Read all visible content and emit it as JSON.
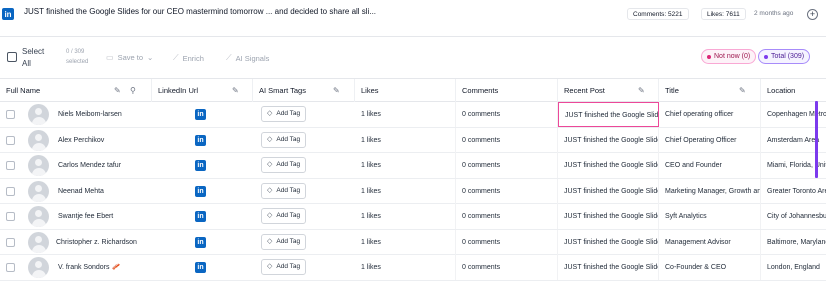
{
  "header": {
    "logo": "in",
    "post_title": "JUST finished the Google Slides for our CEO mastermind tomorrow ... and decided to share all sli...",
    "comments_badge": "Comments: 5221",
    "likes_badge": "Likes: 7611",
    "time_ago": "2 months ago",
    "add_symbol": "+"
  },
  "toolbar": {
    "select_all_label": "Select All",
    "selected_count": "0 / 309 selected",
    "save_to_label": "Save to",
    "save_to_caret": "⌄",
    "enrich_label": "Enrich",
    "ai_signals_label": "AI Signals",
    "not_now_pill": "Not now (0)",
    "total_pill": "Total (309)"
  },
  "columns": {
    "full_name": "Full Name",
    "linkedin_url": "LinkedIn Url",
    "ai_smart_tags": "AI Smart Tags",
    "likes": "Likes",
    "comments": "Comments",
    "recent_post": "Recent Post",
    "title": "Title",
    "location": "Location"
  },
  "add_tag_label": "Add Tag",
  "linkedin_glyph": "in",
  "rows": [
    {
      "name": "Niels Meibom-larsen",
      "likes": "1 likes",
      "comments": "0 comments",
      "recent_post": "JUST finished the Google Slides",
      "title": "Chief operating officer",
      "location": "Copenhagen Metropolitan"
    },
    {
      "name": "Alex Perchikov",
      "likes": "1 likes",
      "comments": "0 comments",
      "recent_post": "JUST finished the Google Slides",
      "title": "Chief Operating Officer",
      "location": "Amsterdam Area"
    },
    {
      "name": "Carlos Mendez tafur",
      "likes": "1 likes",
      "comments": "0 comments",
      "recent_post": "JUST finished the Google Slides",
      "title": "CEO and Founder",
      "location": "Miami, Florida, United"
    },
    {
      "name": "Neenad Mehta",
      "likes": "1 likes",
      "comments": "0 comments",
      "recent_post": "JUST finished the Google Slides",
      "title": "Marketing Manager, Growth and",
      "location": "Greater Toronto Area"
    },
    {
      "name": "Swantje fee Ebert",
      "likes": "1 likes",
      "comments": "0 comments",
      "recent_post": "JUST finished the Google Slides",
      "title": "Syft Analytics",
      "location": "City of Johannesburg"
    },
    {
      "name": "Christopher z. Richardson",
      "likes": "1 likes",
      "comments": "0 comments",
      "recent_post": "JUST finished the Google Slides",
      "title": "Management Advisor",
      "location": "Baltimore, Maryland"
    },
    {
      "name": "V. frank Sondors 🥓",
      "likes": "1 likes",
      "comments": "0 comments",
      "recent_post": "JUST finished the Google Slides",
      "title": "Co-Founder & CEO",
      "location": "London, England"
    }
  ],
  "colors": {
    "linkedin_blue": "#0a66c2",
    "not_now_pink": "#db2777",
    "total_purple": "#7c3aed",
    "selected_cell_border": "#ec4899"
  }
}
